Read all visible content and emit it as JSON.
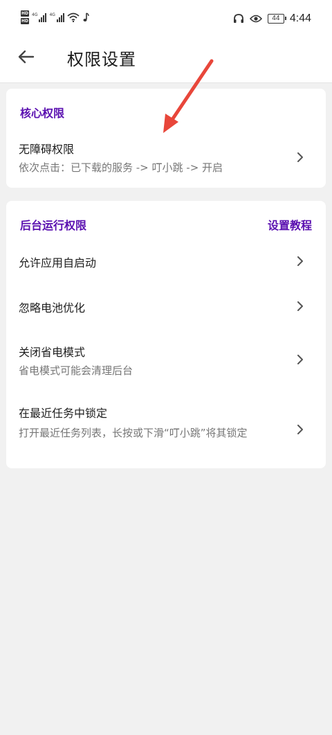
{
  "status_bar": {
    "time": "4:44",
    "battery": "44",
    "signal_1": "4G",
    "signal_2": "4G",
    "hd_1": "HD",
    "hd_2": "HD"
  },
  "header": {
    "title": "权限设置",
    "back_icon": "arrow-left-icon"
  },
  "core_section": {
    "title": "核心权限",
    "items": [
      {
        "title": "无障碍权限",
        "subtitle": "依次点击：已下载的服务 -> 叮小跳 -> 开启"
      }
    ]
  },
  "background_section": {
    "title": "后台运行权限",
    "tutorial_link": "设置教程",
    "items": [
      {
        "title": "允许应用自启动",
        "subtitle": ""
      },
      {
        "title": "忽略电池优化",
        "subtitle": ""
      },
      {
        "title": "关闭省电模式",
        "subtitle": "省电模式可能会清理后台"
      },
      {
        "title": "在最近任务中锁定",
        "subtitle": "打开最近任务列表，长按或下滑“叮小跳”将其锁定"
      }
    ]
  },
  "colors": {
    "accent": "#5a0fb0",
    "annotation_arrow": "#e8463a",
    "background": "#f1f1f1"
  }
}
